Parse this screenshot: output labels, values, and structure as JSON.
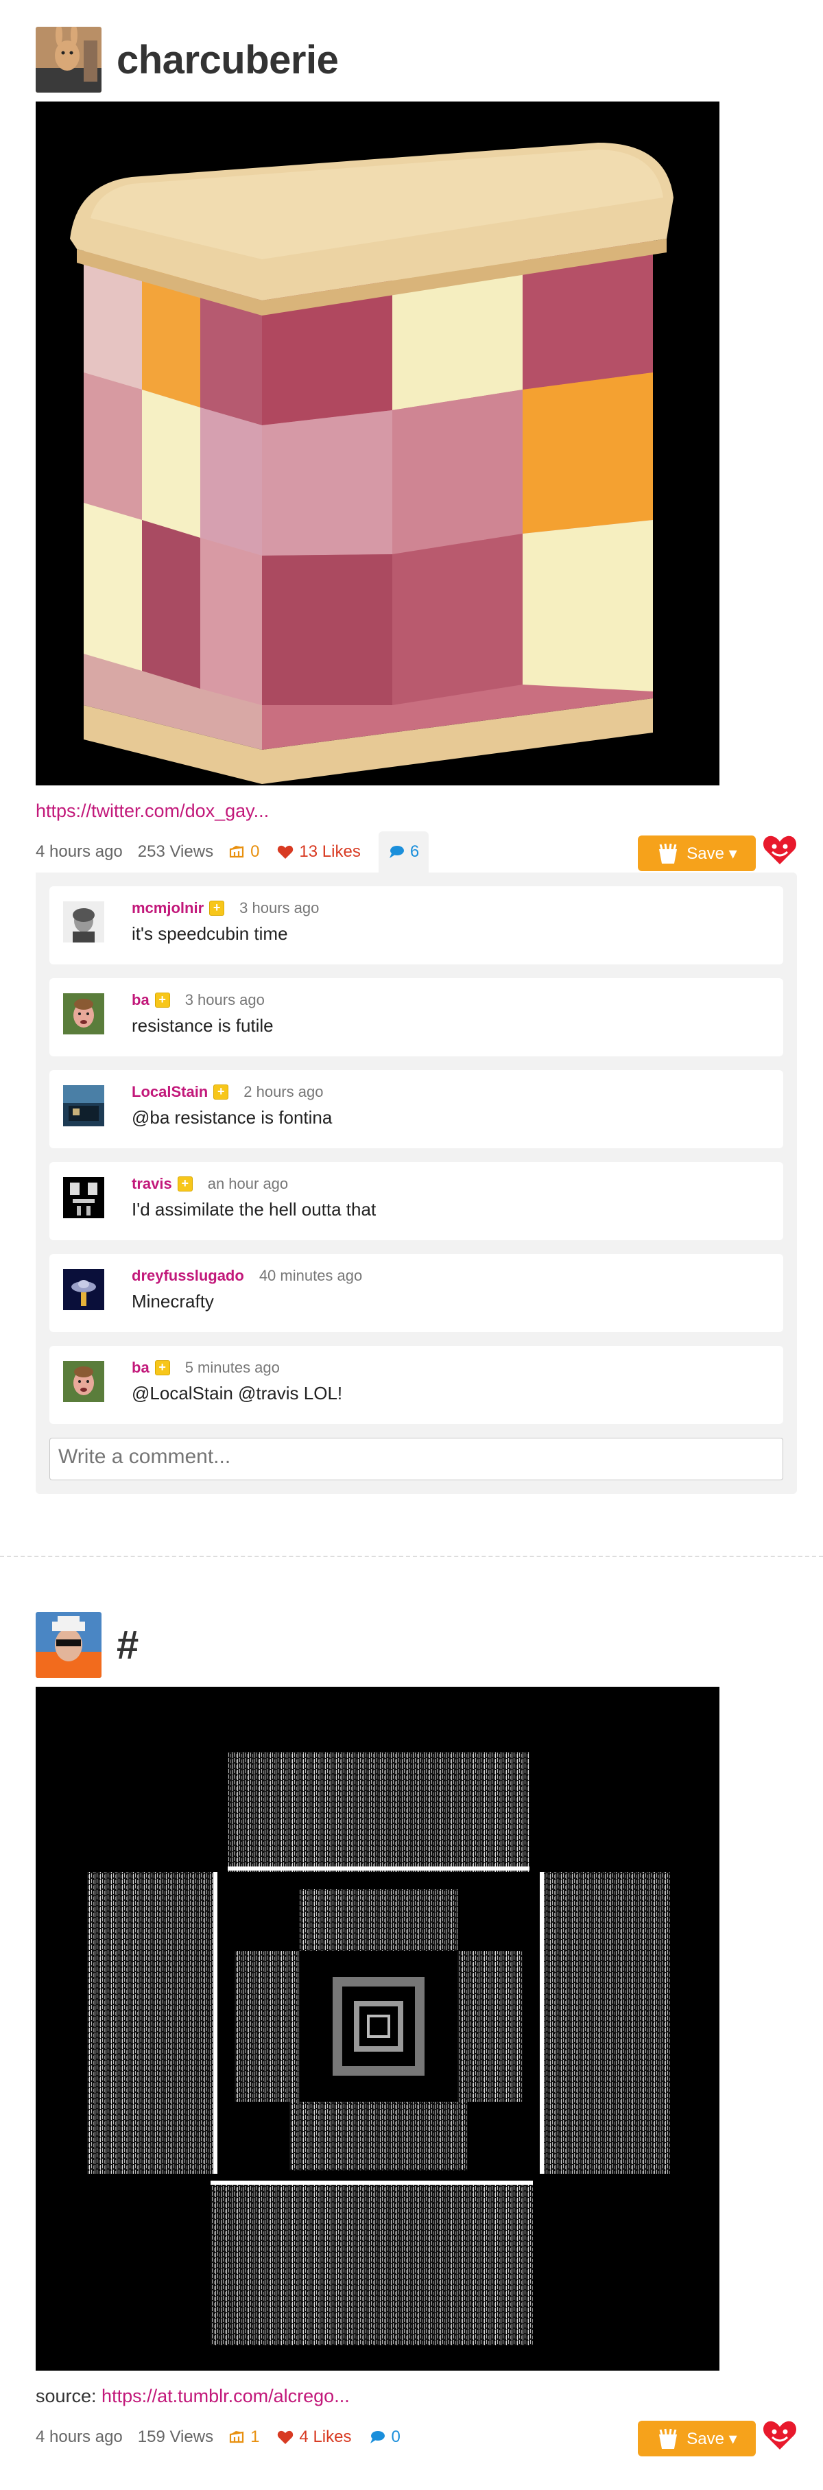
{
  "posts": [
    {
      "title": "charcuberie",
      "source_prefix": "",
      "link_text": "https://twitter.com/dox_gay...",
      "time": "4 hours ago",
      "views": "253 Views",
      "cheese_count": "0",
      "likes": "13 Likes",
      "comment_count": "6",
      "save_label": "Save ▾",
      "comment_placeholder": "Write a comment...",
      "comments": [
        {
          "user": "mcmjolnir",
          "badge": "+",
          "time": "3 hours ago",
          "text": "it's speedcubin time"
        },
        {
          "user": "ba",
          "badge": "+",
          "time": "3 hours ago",
          "text": "resistance is futile"
        },
        {
          "user": "LocalStain",
          "badge": "+",
          "time": "2 hours ago",
          "text": "@ba resistance is fontina"
        },
        {
          "user": "travis",
          "badge": "+",
          "time": "an hour ago",
          "text": "I'd assimilate the hell outta that"
        },
        {
          "user": "dreyfusslugado",
          "badge": "",
          "time": "40 minutes ago",
          "text": "Minecrafty"
        },
        {
          "user": "ba",
          "badge": "+",
          "time": "5 minutes ago",
          "text": "@LocalStain @travis LOL!"
        }
      ]
    },
    {
      "title": "#",
      "source_prefix": "source: ",
      "link_text": "https://at.tumblr.com/alcrego...",
      "time": "4 hours ago",
      "views": "159 Views",
      "cheese_count": "1",
      "likes": "4 Likes",
      "comment_count": "0",
      "save_label": "Save ▾"
    }
  ],
  "colors": {
    "accent_link": "#c2187a",
    "save_button": "#f6a21b",
    "likes": "#d83a22",
    "comments": "#1b8fdb",
    "cheese": "#e8900f"
  },
  "icons": [
    "cheese-icon",
    "heart-icon",
    "speech-bubble-icon",
    "heart-face-icon",
    "plus-badge-icon"
  ]
}
